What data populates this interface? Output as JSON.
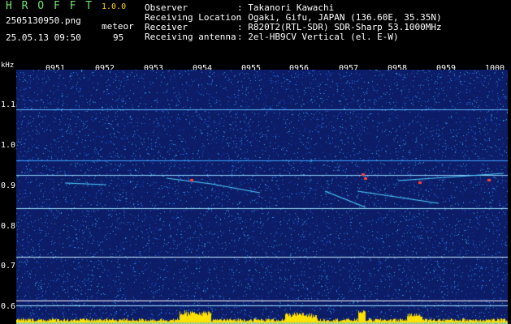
{
  "header": {
    "title": "H R O F F T",
    "version": "1.0.0",
    "filename": "2505130950.png",
    "type_label": "meteor",
    "datetime": "25.05.13 09:50",
    "count": "95",
    "info": [
      {
        "label": "Observer",
        "value": ": Takanori Kawachi"
      },
      {
        "label": "Receiving Location",
        "value": ": Ogaki, Gifu, JAPAN (136.60E, 35.35N)"
      },
      {
        "label": "Receiver",
        "value": ": R820T2(RTL-SDR) SDR-Sharp 53.1000MHz"
      },
      {
        "label": "Receiving antenna",
        "value": ": 2el-HB9CV Vertical (el. E-W)"
      }
    ]
  },
  "spectrogram": {
    "y_unit": "kHz",
    "y_ticks": [
      "1.1",
      "1.0",
      "0.9",
      "0.8",
      "0.7",
      "0.6"
    ],
    "x_ticks": [
      "0951",
      "0952",
      "0953",
      "0954",
      "0955",
      "0956",
      "0957",
      "0958",
      "0959",
      "1000"
    ],
    "colors": {
      "background": "#0c1c66",
      "noise": [
        "#1f4fd6",
        "#2d86e8",
        "#12329a",
        "#3aa9e6",
        "#0a2a9e"
      ],
      "echo_line": "#4fd0ff",
      "echo_hot": "#ff4040",
      "bottom_band": "#ffe000"
    }
  }
}
